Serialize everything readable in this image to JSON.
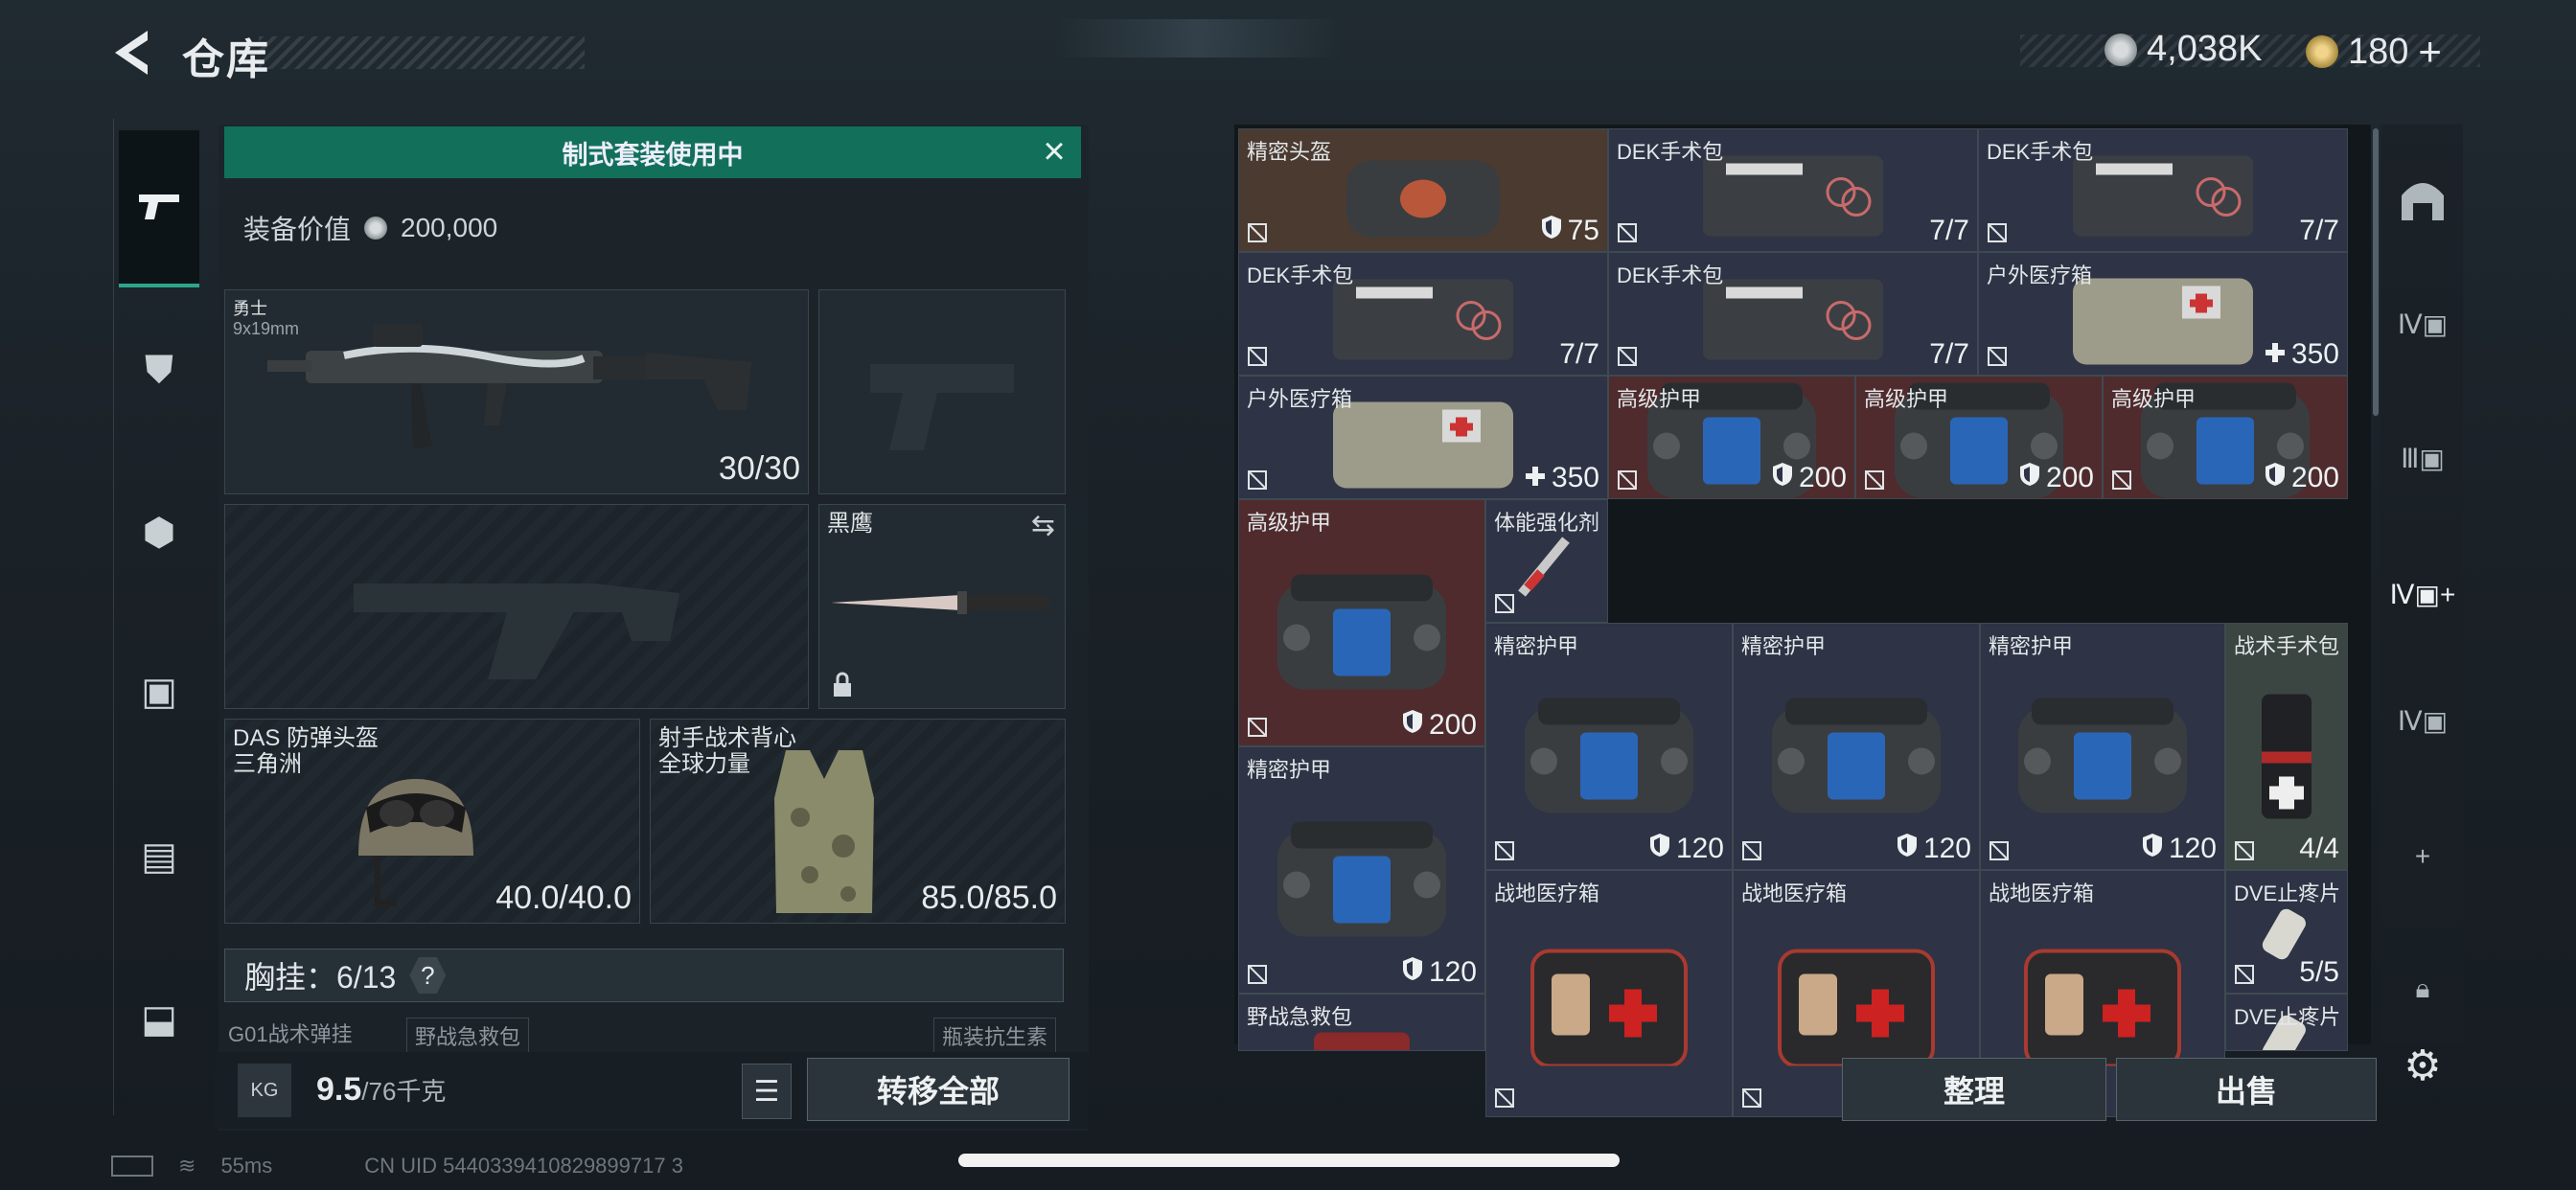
{
  "header": {
    "title": "仓库",
    "currency1": "4,038K",
    "currency2": "180",
    "add": "+"
  },
  "loadout": {
    "banner": "制式套装使用中",
    "value_label": "装备价值",
    "value": "200,000",
    "primary": {
      "name": "勇士",
      "sub": "9x19mm",
      "ammo": "30/30"
    },
    "melee": {
      "name": "黑鹰"
    },
    "helmet": {
      "name": "DAS 防弹头盔\n三角洲",
      "durability": "40.0/40.0"
    },
    "armor": {
      "name": "射手战术背心\n全球力量",
      "durability": "85.0/85.0"
    },
    "chest_rig": {
      "label": "胸挂：6/13",
      "help": "?"
    },
    "subslots": [
      "G01战术弹挂",
      "野战急救包",
      "瓶装抗生素"
    ],
    "weight": "9.5",
    "weight_max": "/76千克",
    "weight_icon": "KG",
    "transfer_all": "转移全部"
  },
  "stash_buttons": {
    "sort": "整理",
    "sell": "出售"
  },
  "stash_items": [
    {
      "name": "精密头盔",
      "qty": "75",
      "icon": "shield",
      "color": "brown"
    },
    {
      "name": "DEK手术包",
      "qty": "7/7",
      "color": "navy"
    },
    {
      "name": "DEK手术包",
      "qty": "7/7",
      "color": "navy"
    },
    {
      "name": "DEK手术包",
      "qty": "7/7",
      "color": "navy"
    },
    {
      "name": "DEK手术包",
      "qty": "7/7",
      "color": "navy"
    },
    {
      "name": "户外医疗箱",
      "qty": "350",
      "icon": "plus",
      "color": "navy"
    },
    {
      "name": "户外医疗箱",
      "qty": "350",
      "icon": "plus",
      "color": "navy"
    },
    {
      "name": "高级护甲",
      "qty": "200",
      "icon": "shield",
      "color": "red"
    },
    {
      "name": "高级护甲",
      "qty": "200",
      "icon": "shield",
      "color": "red"
    },
    {
      "name": "高级护甲",
      "qty": "200",
      "icon": "shield",
      "color": "red"
    },
    {
      "name": "高级护甲",
      "qty": "200",
      "icon": "shield",
      "color": "red"
    },
    {
      "name": "体能强化剂",
      "qty": "",
      "color": "navy"
    },
    {
      "name": "精密护甲",
      "qty": "120",
      "icon": "shield",
      "color": "navy"
    },
    {
      "name": "精密护甲",
      "qty": "120",
      "icon": "shield",
      "color": "navy"
    },
    {
      "name": "精密护甲",
      "qty": "120",
      "icon": "shield",
      "color": "navy"
    },
    {
      "name": "战术手术包",
      "qty": "4/4",
      "color": "green"
    },
    {
      "name": "精密护甲",
      "qty": "120",
      "icon": "shield",
      "color": "navy"
    },
    {
      "name": "战地医疗箱",
      "qty": "",
      "color": "navy"
    },
    {
      "name": "战地医疗箱",
      "qty": "",
      "color": "navy"
    },
    {
      "name": "战地医疗箱",
      "qty": "",
      "color": "navy"
    },
    {
      "name": "DVE止疼片",
      "qty": "5/5",
      "color": "navy"
    },
    {
      "name": "野战急救包",
      "qty": "",
      "color": "navy"
    },
    {
      "name": "DVE止疼片",
      "qty": "",
      "color": "navy"
    }
  ],
  "status": {
    "ping": "55ms",
    "uid": "CN UID 5440339410829899717 3"
  },
  "colors": {
    "accent": "#12705a",
    "red_cell": "#4f2b2d",
    "navy_cell": "#2e3345",
    "brown_cell": "#4a3a30"
  }
}
